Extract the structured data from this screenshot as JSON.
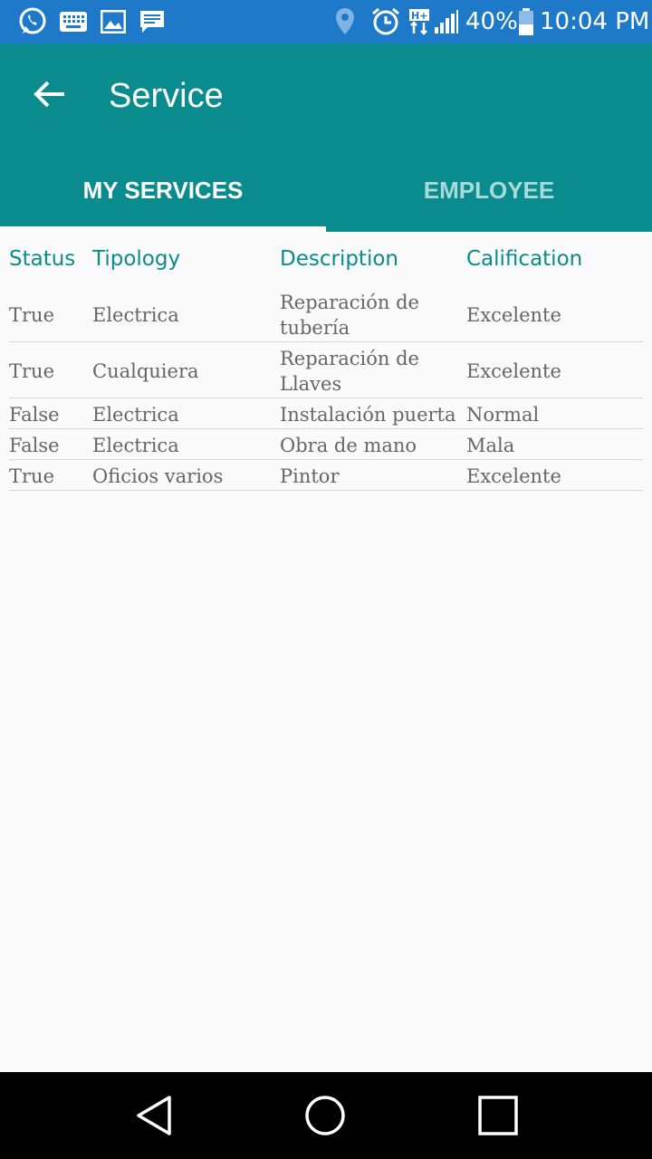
{
  "status_bar": {
    "time": "10:04 PM",
    "battery": "40%.",
    "icons": [
      "whatsapp-icon",
      "keyboard-icon",
      "image-icon",
      "message-icon",
      "location-icon",
      "alarm-icon",
      "hplus-data-icon",
      "signal-icon",
      "battery-icon"
    ]
  },
  "app_bar": {
    "title": "Service",
    "back_icon": "arrow-left-icon",
    "color": "#0a8b8d"
  },
  "tabs": [
    {
      "label": "MY SERVICES",
      "selected": true
    },
    {
      "label": "EMPLOYEE",
      "selected": false
    }
  ],
  "table": {
    "headers": [
      "Status",
      "Tipology",
      "Description",
      "Calification"
    ],
    "rows": [
      {
        "status": "True",
        "tipology": "Electrica",
        "description": "Reparación de tubería",
        "calification": "Excelente"
      },
      {
        "status": "True",
        "tipology": "Cualquiera",
        "description": "Reparación de Llaves",
        "calification": "Excelente"
      },
      {
        "status": "False",
        "tipology": "Electrica",
        "description": "Instalación puerta",
        "calification": "Normal"
      },
      {
        "status": "False",
        "tipology": "Electrica",
        "description": "Obra de mano",
        "calification": "Mala"
      },
      {
        "status": "True",
        "tipology": "Oficios varios",
        "description": "Pintor",
        "calification": "Excelente"
      }
    ]
  },
  "nav_bar": {
    "buttons": [
      "back-triangle-icon",
      "home-circle-icon",
      "recents-square-icon"
    ]
  }
}
